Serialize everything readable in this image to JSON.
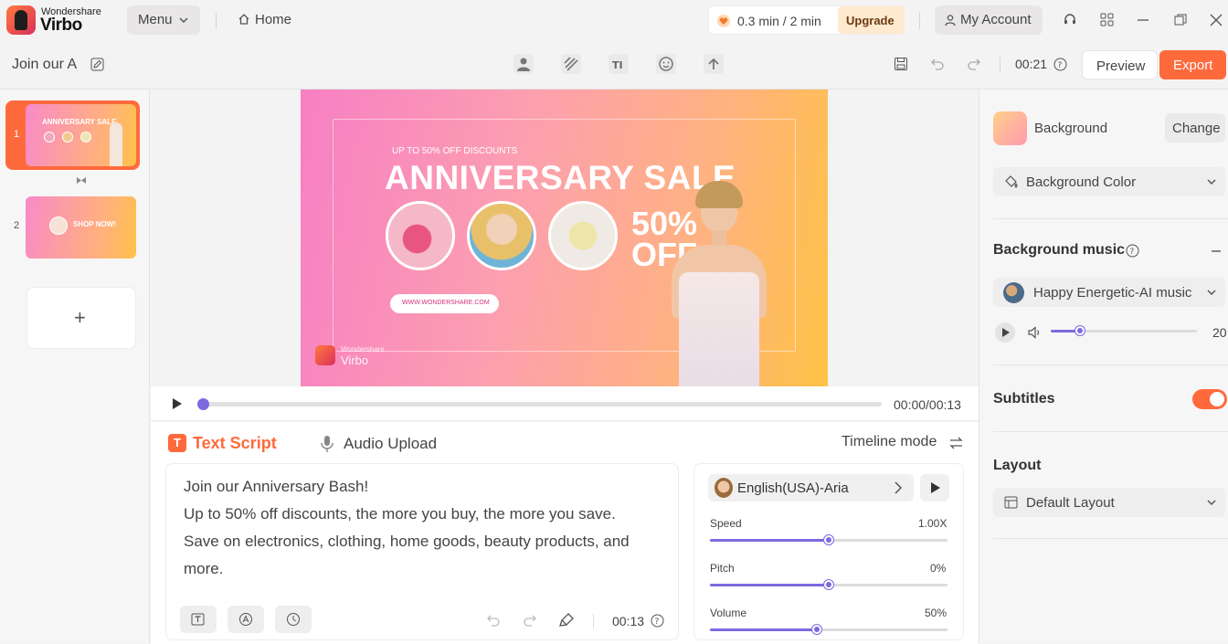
{
  "app": {
    "brand_top": "Wondershare",
    "brand_bottom": "Virbo"
  },
  "titlebar": {
    "menu_label": "Menu",
    "home_label": "Home",
    "usage": "0.3 min / 2 min",
    "upgrade_label": "Upgrade",
    "account_label": "My Account"
  },
  "toolbar": {
    "project_name": "Join our A",
    "duration": "00:21",
    "preview_label": "Preview",
    "export_label": "Export"
  },
  "slides": {
    "items": [
      {
        "number": "1",
        "title": "ANNIVERSARY SALE"
      },
      {
        "number": "2",
        "title": "SHOP NOW!"
      }
    ],
    "add_label": "+"
  },
  "canvas": {
    "small_text": "UP TO 50% OFF DISCOUNTS",
    "headline": "ANNIVERSARY SALE",
    "offer_line1": "50%",
    "offer_line2": "OFF",
    "url": "WWW.WONDERSHARE.COM",
    "logo_top": "Wondershare",
    "logo_bottom": "Virbo"
  },
  "player": {
    "time": "00:00/00:13",
    "progress": 0.0
  },
  "script": {
    "tab_text": "Text Script",
    "tab_audio": "Audio Upload",
    "timeline_label": "Timeline mode",
    "lines": [
      "Join our Anniversary Bash!",
      "Up to 50% off discounts, the more you buy, the more you save.",
      "Save on electronics, clothing, home goods, beauty products, and",
      "more."
    ],
    "duration": "00:13"
  },
  "voice": {
    "name": "English(USA)-Aria",
    "speed_label": "Speed",
    "speed_value": "1.00X",
    "speed_level": 0.5,
    "pitch_label": "Pitch",
    "pitch_value": "0%",
    "pitch_level": 0.5,
    "volume_label": "Volume",
    "volume_value": "50%",
    "volume_level": 0.45
  },
  "right": {
    "background_label": "Background",
    "change_label": "Change",
    "background_color_label": "Background Color",
    "music_title": "Background music",
    "music_name": "Happy Energetic-AI music",
    "music_volume": "20",
    "music_level": 0.2,
    "subtitles_label": "Subtitles",
    "subtitles_on": true,
    "layout_title": "Layout",
    "layout_value": "Default Layout"
  },
  "colors": {
    "accent": "#ff6a3d",
    "slider": "#7b6ae0",
    "upgrade_bg": "#ffe9cf"
  }
}
